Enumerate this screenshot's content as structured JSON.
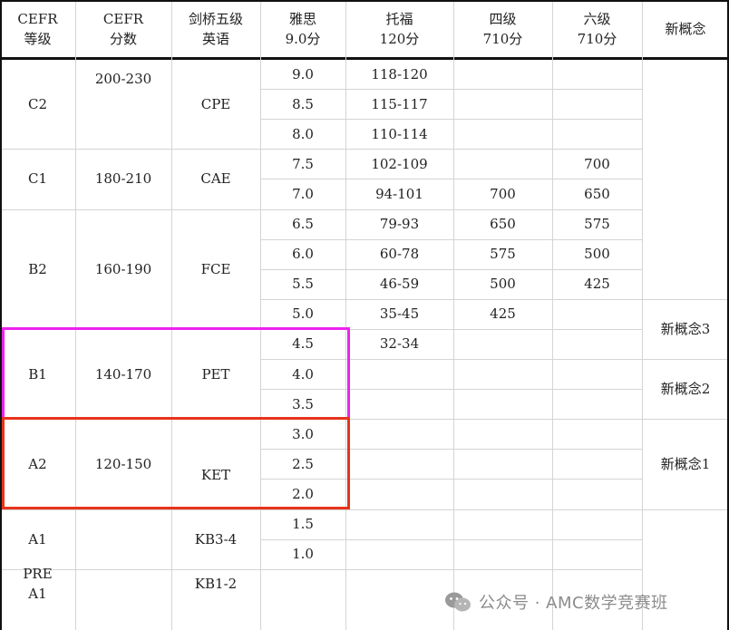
{
  "headers": [
    "CEFR\n等级",
    "CEFR\n分数",
    "剑桥五级\n英语",
    "雅思\n9.0分",
    "托福\n120分",
    "四级\n710分",
    "六级\n710分",
    "新概念"
  ],
  "rows": [
    {
      "ielts": "9.0",
      "toefl": "118-120",
      "cet4": "",
      "cet6": ""
    },
    {
      "ielts": "8.5",
      "toefl": "115-117",
      "cet4": "",
      "cet6": ""
    },
    {
      "ielts": "8.0",
      "toefl": "110-114",
      "cet4": "",
      "cet6": ""
    },
    {
      "ielts": "7.5",
      "toefl": "102-109",
      "cet4": "",
      "cet6": "700"
    },
    {
      "ielts": "7.0",
      "toefl": "94-101",
      "cet4": "700",
      "cet6": "650"
    },
    {
      "ielts": "6.5",
      "toefl": "79-93",
      "cet4": "650",
      "cet6": "575"
    },
    {
      "ielts": "6.0",
      "toefl": "60-78",
      "cet4": "575",
      "cet6": "500"
    },
    {
      "ielts": "5.5",
      "toefl": "46-59",
      "cet4": "500",
      "cet6": "425"
    },
    {
      "ielts": "5.0",
      "toefl": "35-45",
      "cet4": "425",
      "cet6": ""
    },
    {
      "ielts": "4.5",
      "toefl": "32-34",
      "cet4": "",
      "cet6": ""
    },
    {
      "ielts": "4.0",
      "toefl": "",
      "cet4": "",
      "cet6": ""
    },
    {
      "ielts": "3.5",
      "toefl": "",
      "cet4": "",
      "cet6": ""
    },
    {
      "ielts": "3.0",
      "toefl": "",
      "cet4": "",
      "cet6": ""
    },
    {
      "ielts": "2.5",
      "toefl": "",
      "cet4": "",
      "cet6": ""
    },
    {
      "ielts": "2.0",
      "toefl": "",
      "cet4": "",
      "cet6": ""
    },
    {
      "ielts": "1.5",
      "toefl": "",
      "cet4": "",
      "cet6": ""
    },
    {
      "ielts": "1.0",
      "toefl": "",
      "cet4": "",
      "cet6": ""
    },
    {
      "ielts": "",
      "toefl": "",
      "cet4": "",
      "cet6": ""
    }
  ],
  "groups": [
    {
      "level": "C2",
      "score": "200-230",
      "cambridge": "CPE",
      "start": 0,
      "end": 2
    },
    {
      "level": "C1",
      "score": "180-210",
      "cambridge": "CAE",
      "start": 3,
      "end": 4
    },
    {
      "level": "B2",
      "score": "160-190",
      "cambridge": "FCE",
      "start": 5,
      "end": 8
    },
    {
      "level": "B1",
      "score": "140-170",
      "cambridge": "PET",
      "start": 9,
      "end": 11
    },
    {
      "level": "A2",
      "score": "120-150",
      "cambridge": "KET",
      "start": 12,
      "end": 14
    },
    {
      "level": "A1",
      "score": "",
      "cambridge": "KB3-4",
      "start": 15,
      "end": 16
    },
    {
      "level": "PRE\nA1",
      "score": "",
      "cambridge": "KB1-2",
      "start": 17,
      "end": 17
    }
  ],
  "new_concept": [
    {
      "label": "",
      "start": 0,
      "end": 7
    },
    {
      "label": "新概念3",
      "start": 8,
      "end": 9
    },
    {
      "label": "新概念2",
      "start": 10,
      "end": 11
    },
    {
      "label": "新概念1",
      "start": 12,
      "end": 14
    },
    {
      "label": "",
      "start": 15,
      "end": 17
    }
  ],
  "highlights": [
    {
      "group": "B1",
      "color": "#ee22ee"
    },
    {
      "group": "A2",
      "color": "#e8331c"
    }
  ],
  "watermark": {
    "text": "公众号 · AMC数学竞赛班",
    "icon": "wechat-icon"
  }
}
